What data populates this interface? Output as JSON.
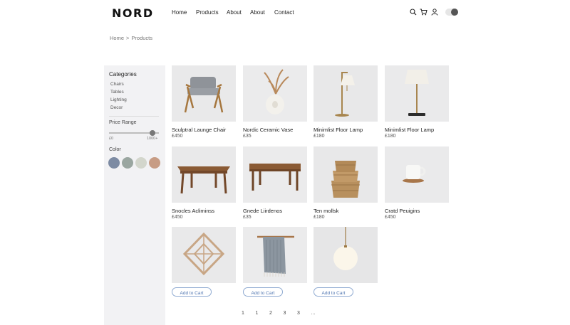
{
  "header": {
    "logo": "NORD",
    "nav": [
      "Home",
      "Products",
      "About",
      "About",
      "Contact"
    ],
    "icons": [
      "search-icon",
      "cart-icon",
      "user-icon"
    ],
    "theme_toggle": "dark-mode-toggle"
  },
  "breadcrumb": {
    "home": "Home",
    "sep": ">",
    "current": "Products"
  },
  "sidebar": {
    "categories_title": "Categories",
    "categories": [
      "Chairs",
      "Tables",
      "Lighting",
      "Decor"
    ],
    "price_title": "Price Range",
    "price_min": "£0",
    "price_max": "1000+",
    "price_level": 0.87,
    "color_title": "Color",
    "colors": [
      "#7d8ba3",
      "#9aa6a0",
      "#d3d6cc",
      "#c79c84"
    ]
  },
  "products": [
    {
      "name": "Sculptral Launge Chair",
      "price": "£450"
    },
    {
      "name": "Nordic Ceramic Vase",
      "price": "£35"
    },
    {
      "name": "Minimlist Floor Lamp",
      "price": "£180"
    },
    {
      "name": "Minimlist Floor Lamp",
      "price": "£180"
    },
    {
      "name": "Snocles Acliminss",
      "price": "£450"
    },
    {
      "name": "Gnede Liirdenos",
      "price": "£35"
    },
    {
      "name": "Ten mollsk",
      "price": "£180"
    },
    {
      "name": "Cratd Peuigins",
      "price": "£450"
    },
    {
      "cart": "Add to Cart"
    },
    {
      "cart": "Add to Cart"
    },
    {
      "cart": "Add to Cart"
    }
  ],
  "pagination": [
    "1",
    "1",
    "2",
    "3",
    "3",
    "..."
  ]
}
